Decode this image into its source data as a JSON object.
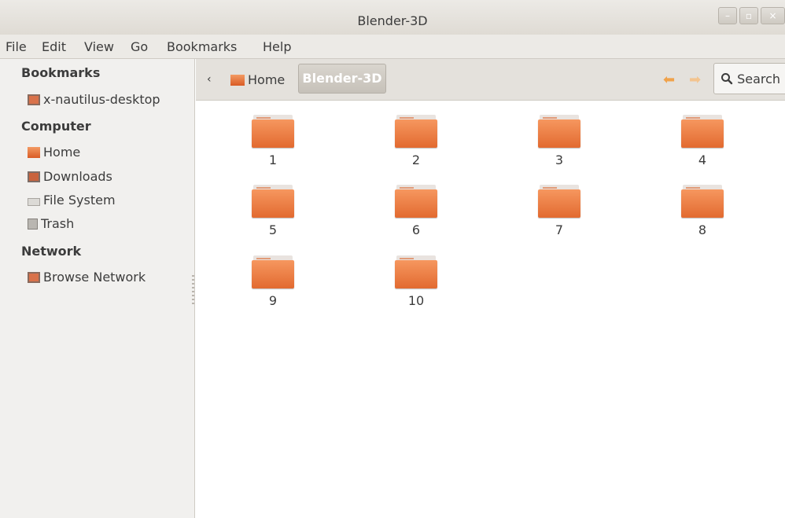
{
  "window": {
    "title": "Blender-3D",
    "controls": {
      "minimize": "–",
      "maximize": "▫",
      "close": "×"
    }
  },
  "menubar": [
    "File",
    "Edit",
    "View",
    "Go",
    "Bookmarks",
    "Help"
  ],
  "sidebar": {
    "sections": [
      {
        "heading": "Bookmarks",
        "items": [
          {
            "label": "x-nautilus-desktop",
            "icon": "desktop-icon"
          }
        ]
      },
      {
        "heading": "Computer",
        "items": [
          {
            "label": "Home",
            "icon": "home-folder-icon"
          },
          {
            "label": "Downloads",
            "icon": "downloads-icon"
          },
          {
            "label": "File System",
            "icon": "drive-icon"
          },
          {
            "label": "Trash",
            "icon": "trash-icon"
          }
        ]
      },
      {
        "heading": "Network",
        "items": [
          {
            "label": "Browse Network",
            "icon": "network-icon"
          }
        ]
      }
    ]
  },
  "toolbar": {
    "back_glyph": "‹",
    "breadcrumbs": [
      "Home",
      "Blender-3D"
    ],
    "search_label": "Search"
  },
  "folders": [
    "1",
    "2",
    "3",
    "4",
    "5",
    "6",
    "7",
    "8",
    "9",
    "10"
  ],
  "colors": {
    "accent": "#e8643a",
    "folder": "#f08a4b",
    "sidebar_bg": "#f1f0ee"
  }
}
